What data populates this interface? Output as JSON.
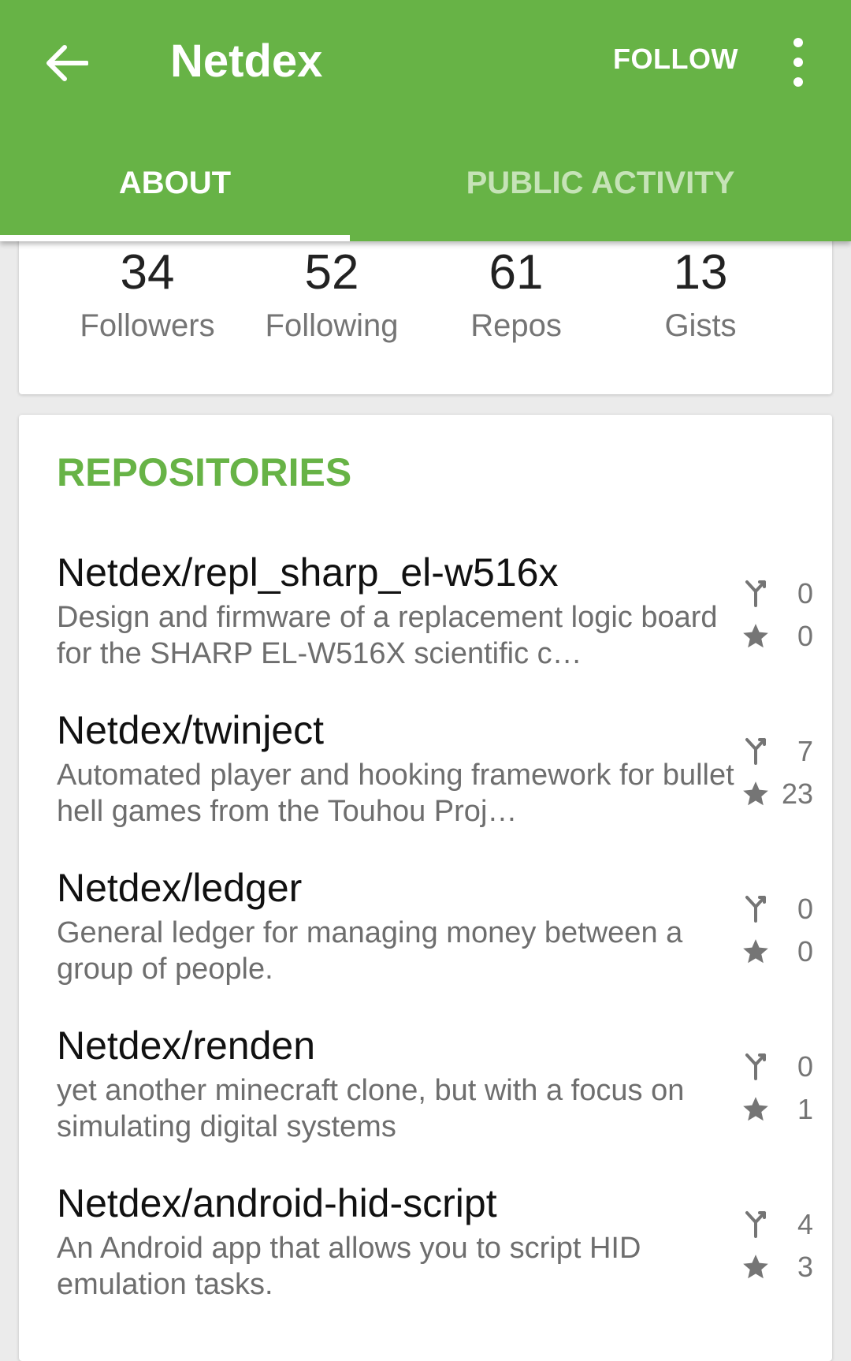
{
  "appbar": {
    "title": "Netdex",
    "follow_label": "FOLLOW",
    "color": "#67b346"
  },
  "tabs": [
    {
      "label": "ABOUT",
      "active": true
    },
    {
      "label": "PUBLIC ACTIVITY",
      "active": false
    }
  ],
  "stats": [
    {
      "value": "34",
      "label": "Followers"
    },
    {
      "value": "52",
      "label": "Following"
    },
    {
      "value": "61",
      "label": "Repos"
    },
    {
      "value": "13",
      "label": "Gists"
    }
  ],
  "repositories": {
    "title": "REPOSITORIES",
    "items": [
      {
        "name": "Netdex/repl_sharp_el-w516x",
        "description": "Design and firmware of a replacement logic board for the SHARP EL-W516X scientific c…",
        "forks": "0",
        "stars": "0"
      },
      {
        "name": "Netdex/twinject",
        "description": "Automated player and hooking framework for bullet hell games from the Touhou Proj…",
        "forks": "7",
        "stars": "23"
      },
      {
        "name": "Netdex/ledger",
        "description": "General ledger for managing money between a group of people.",
        "forks": "0",
        "stars": "0"
      },
      {
        "name": "Netdex/renden",
        "description": "yet another minecraft clone, but with a focus on simulating digital systems",
        "forks": "0",
        "stars": "1"
      },
      {
        "name": "Netdex/android-hid-script",
        "description": "An Android app that allows you to script HID emulation tasks.",
        "forks": "4",
        "stars": "3"
      }
    ]
  }
}
